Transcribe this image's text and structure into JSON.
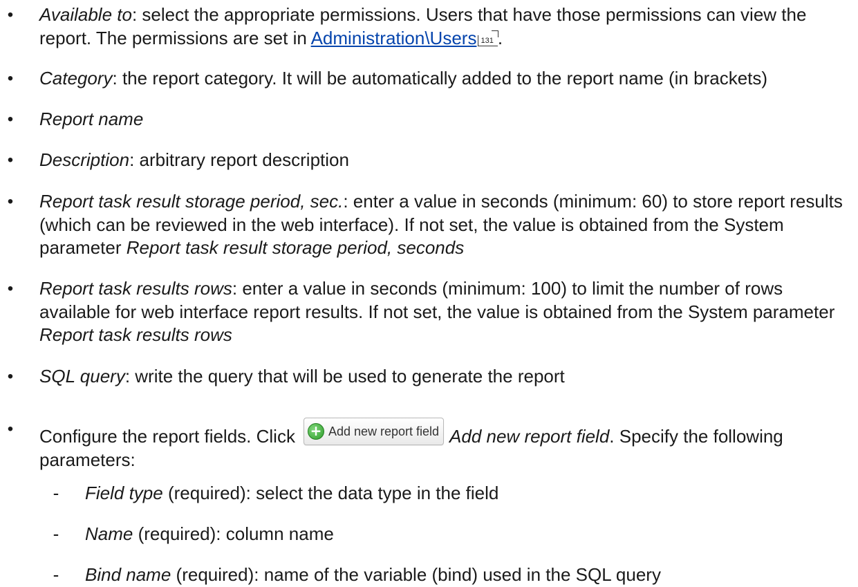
{
  "items": [
    {
      "term": "Available to",
      "text": ": select the appropriate permissions. Users that have those permissions can view the report. The permissions are set in ",
      "link": "Administration\\Users",
      "page_ref": "131",
      "tail": "."
    },
    {
      "term": "Category",
      "text": ": the report category. It will be automatically added to the report name (in brackets)"
    },
    {
      "term": "Report name"
    },
    {
      "term": "Description",
      "text": ": arbitrary report description"
    },
    {
      "term": "Report task result storage period, sec.",
      "text": ": enter a value in seconds (minimum: 60) to store report results (which can be reviewed in the web interface). If not set, the value is obtained from the System parameter ",
      "ref": "Report task result storage period, seconds"
    },
    {
      "term": "Report task results rows",
      "text": ": enter a value in seconds (minimum: 100) to limit the number of rows available for web interface report results. If not set, the value is obtained from the System parameter ",
      "ref": "Report task results rows"
    },
    {
      "term": "SQL query",
      "text": ": write the query that will be used to generate the report"
    },
    {
      "pre": "Configure the report fields. Click",
      "button_label": "Add new report field",
      "term": "Add new report field",
      "text": ". Specify the following parameters:"
    }
  ],
  "subitems": [
    {
      "term": "Field type",
      "text": " (required): select the data type in the field"
    },
    {
      "term": "Name",
      "text": " (required): column name"
    },
    {
      "term": "Bind name",
      "text": " (required): name of the variable (bind) used in the SQL query"
    }
  ],
  "bullet_char": "•",
  "dash_char": "-",
  "link_color": "#0645ad",
  "icons": {
    "add_button": "green-plus-circle-icon",
    "page_ref": "page-reference-icon"
  }
}
